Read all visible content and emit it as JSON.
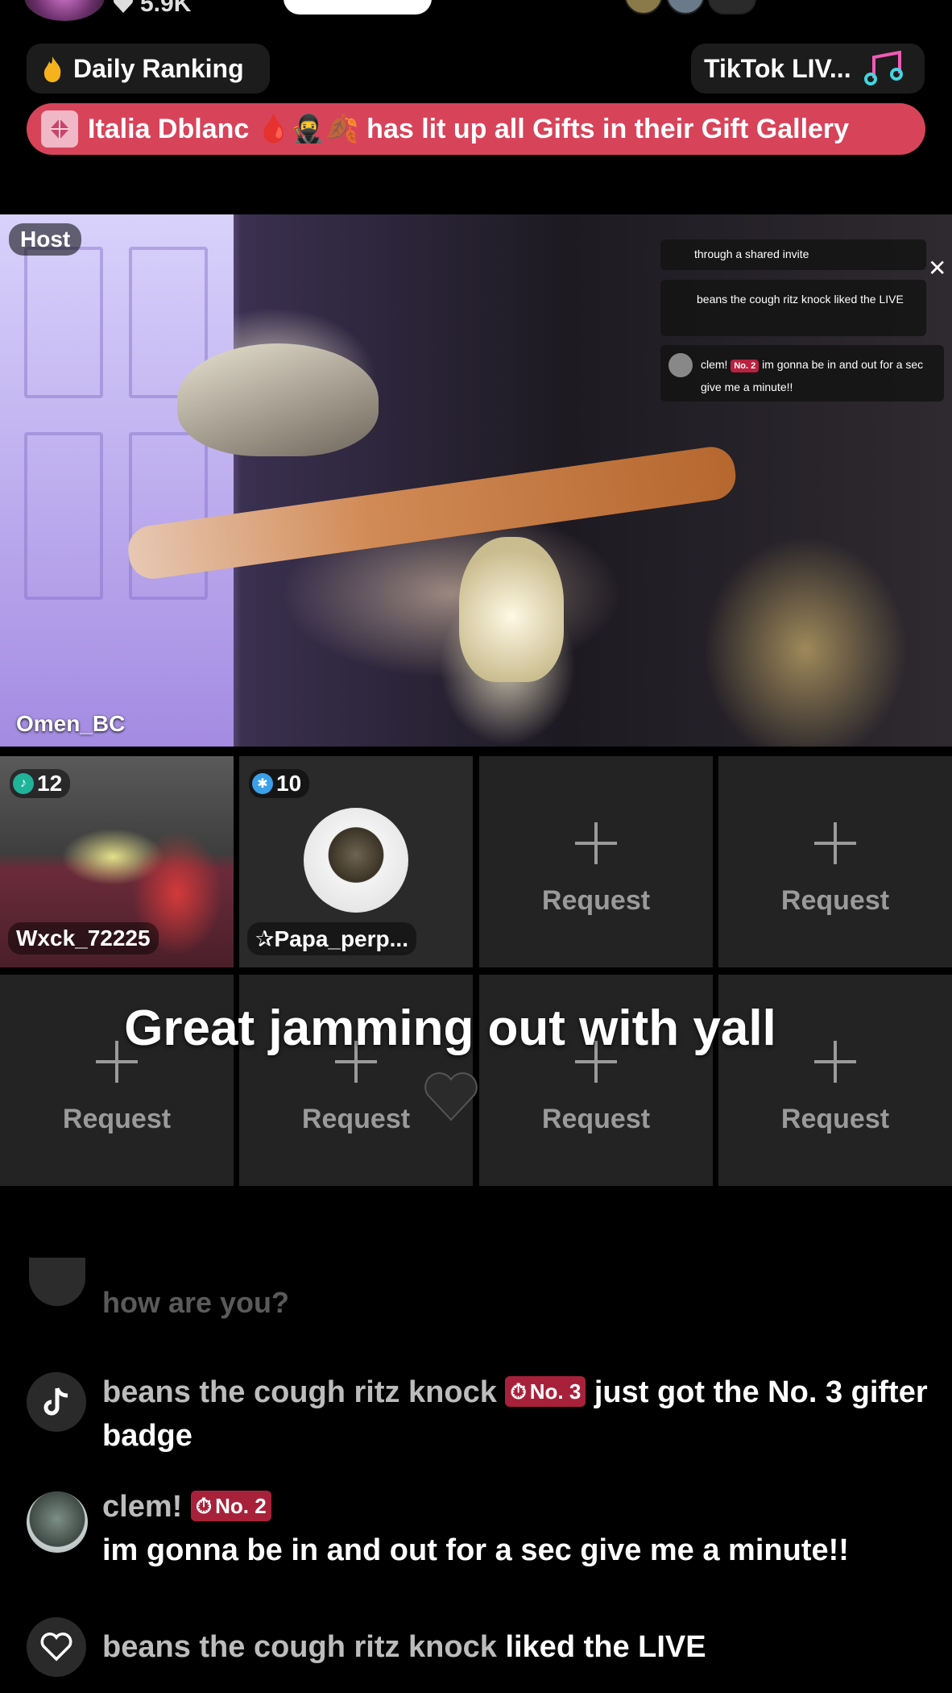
{
  "top": {
    "likes": "5.9K"
  },
  "chips": {
    "daily_ranking": "Daily Ranking",
    "tiktok_live": "TikTok LIV..."
  },
  "banner": {
    "text": "Italia Dblanc 🩸🥷🍂 has lit up all Gifts in their Gift Gallery"
  },
  "host": {
    "badge": "Host",
    "name": "Omen_BC"
  },
  "mini_chat": {
    "line1": "through a shared invite",
    "line2_name": "beans the cough ritz knock",
    "line2_text": "liked the LIVE",
    "line3_name": "clem!",
    "line3_badge": "No. 2",
    "line3_text": "im gonna be in and out for a sec give me a minute!!"
  },
  "guests": [
    {
      "score": "12",
      "name": "Wxck_72225",
      "color": "#1fb39a"
    },
    {
      "score": "10",
      "name": "✰Papa_perp...",
      "color": "#3aa0e8"
    }
  ],
  "request_label": "Request",
  "caption": "Great jamming out with yall",
  "comments": {
    "faded": "how are you?",
    "c1_name": "beans the cough ritz knock",
    "c1_badge": "No. 3",
    "c1_text": "just got the No. 3 gifter badge",
    "c2_name": "clem!",
    "c2_badge": "No. 2",
    "c2_text": "im gonna be in and out for a sec give me a minute!!",
    "c3_name": "beans the cough ritz knock",
    "c3_text": "liked the LIVE"
  },
  "colors": {
    "banner": "#d7445a",
    "badge": "#a8213a",
    "chip": "#1c1c1c"
  }
}
